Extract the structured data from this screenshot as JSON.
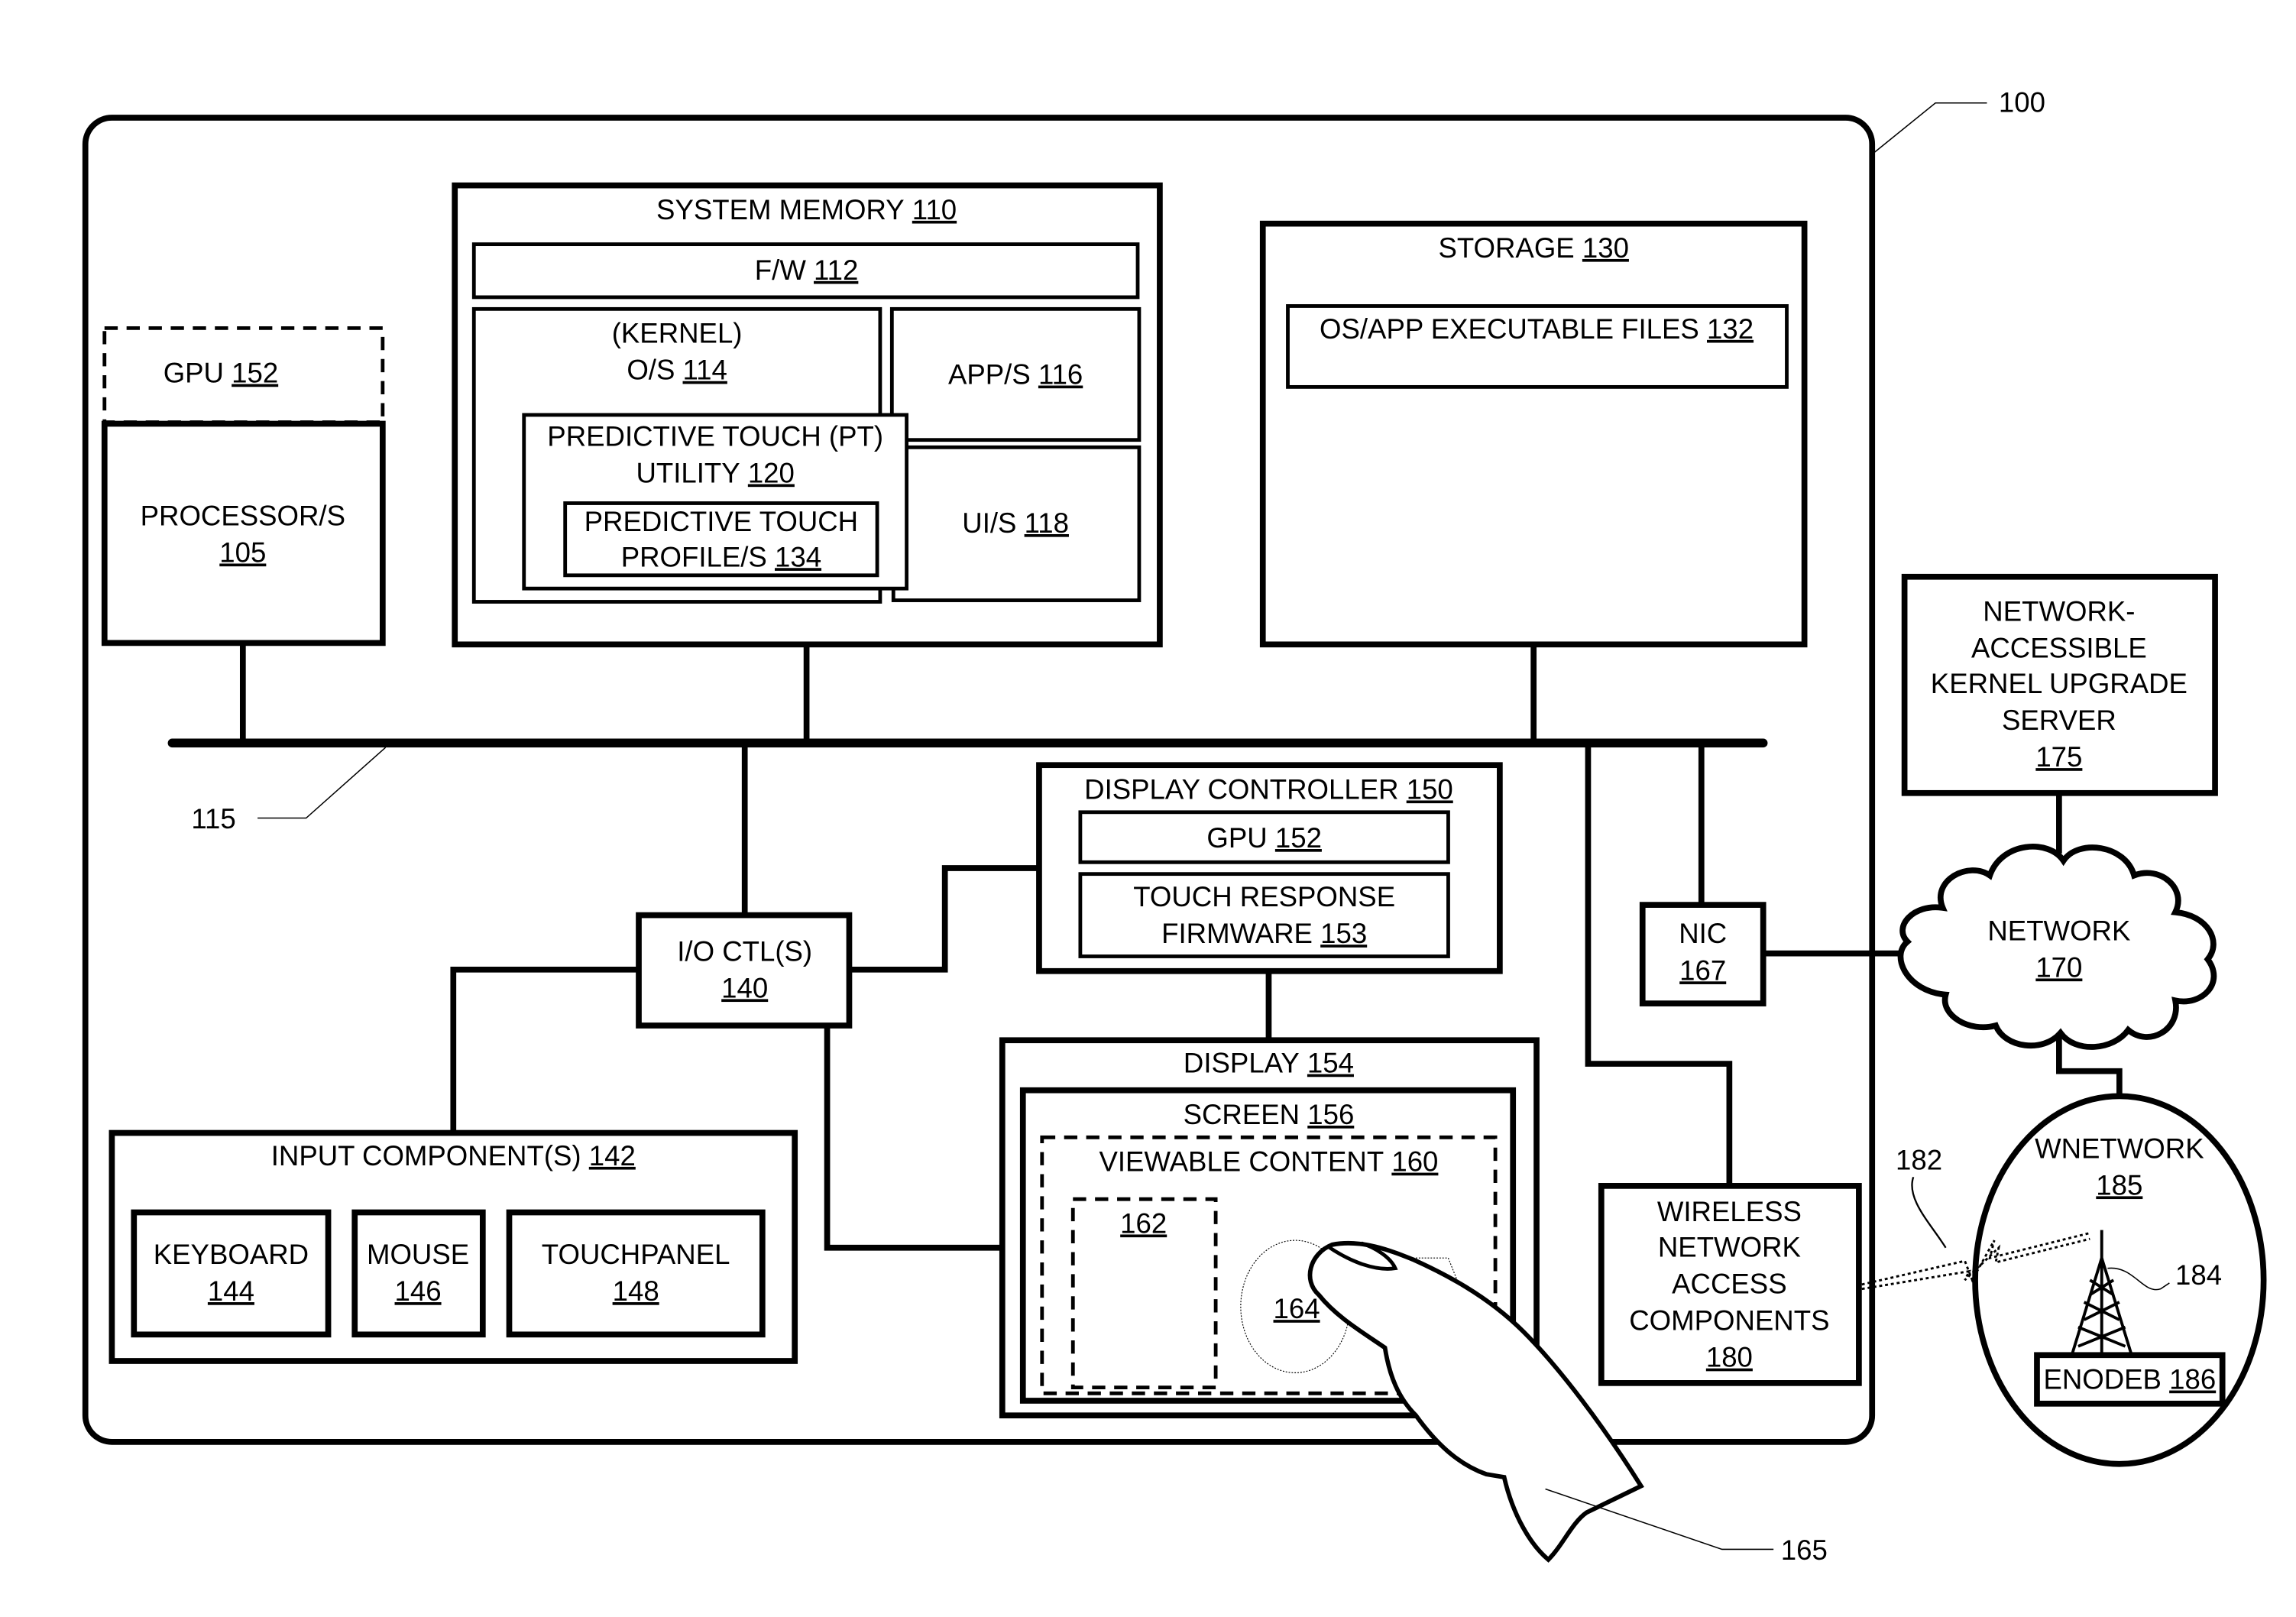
{
  "figure": {
    "device_ref": "100",
    "bus_ref": "115",
    "finger_ref": "165",
    "wireless_link_ref": "182",
    "tower_ref": "184"
  },
  "components": {
    "gpu_top": {
      "name": "GPU",
      "ref": "152"
    },
    "processor": {
      "line1": "PROCESSOR/S",
      "ref": "105"
    },
    "system_memory": {
      "name": "SYSTEM MEMORY",
      "ref": "110"
    },
    "firmware": {
      "name": "F/W",
      "ref": "112"
    },
    "os": {
      "line1": "(KERNEL)",
      "name": "O/S",
      "ref": "114"
    },
    "apps": {
      "name": "APP/S",
      "ref": "116"
    },
    "uis": {
      "name": "UI/S",
      "ref": "118"
    },
    "pt_utility": {
      "line1": "PREDICTIVE TOUCH (PT)",
      "name": "UTILITY",
      "ref": "120"
    },
    "pt_profiles": {
      "line1": "PREDICTIVE TOUCH",
      "name": "PROFILE/S",
      "ref": "134"
    },
    "storage": {
      "name": "STORAGE",
      "ref": "130"
    },
    "exec_files": {
      "name": "OS/APP EXECUTABLE FILES",
      "ref": "132"
    },
    "display_controller": {
      "name": "DISPLAY CONTROLLER",
      "ref": "150"
    },
    "gpu_dc": {
      "name": "GPU",
      "ref": "152"
    },
    "touch_fw": {
      "line1": "TOUCH RESPONSE",
      "name": "FIRMWARE",
      "ref": "153"
    },
    "io_ctl": {
      "line1": "I/O CTL(S)",
      "ref": "140"
    },
    "input_components": {
      "name": "INPUT COMPONENT(S)",
      "ref": "142"
    },
    "keyboard": {
      "line1": "KEYBOARD",
      "ref": "144"
    },
    "mouse": {
      "line1": "MOUSE",
      "ref": "146"
    },
    "touchpanel": {
      "line1": "TOUCHPANEL",
      "ref": "148"
    },
    "display": {
      "name": "DISPLAY",
      "ref": "154"
    },
    "screen": {
      "name": "SCREEN",
      "ref": "156"
    },
    "viewable": {
      "name": "VIEWABLE CONTENT",
      "ref": "160"
    },
    "region_162": {
      "ref": "162"
    },
    "region_164": {
      "ref": "164"
    },
    "nic": {
      "line1": "NIC",
      "ref": "167"
    },
    "wireless": {
      "lines": [
        "WIRELESS",
        "NETWORK",
        "ACCESS",
        "COMPONENTS"
      ],
      "ref": "180"
    },
    "server": {
      "lines": [
        "NETWORK-",
        "ACCESSIBLE",
        "KERNEL UPGRADE",
        "SERVER"
      ],
      "ref": "175"
    },
    "network": {
      "line1": "NETWORK",
      "ref": "170"
    },
    "wnetwork": {
      "line1": "WNETWORK",
      "ref": "185"
    },
    "enodeb": {
      "name": "ENODEB",
      "ref": "186"
    }
  }
}
